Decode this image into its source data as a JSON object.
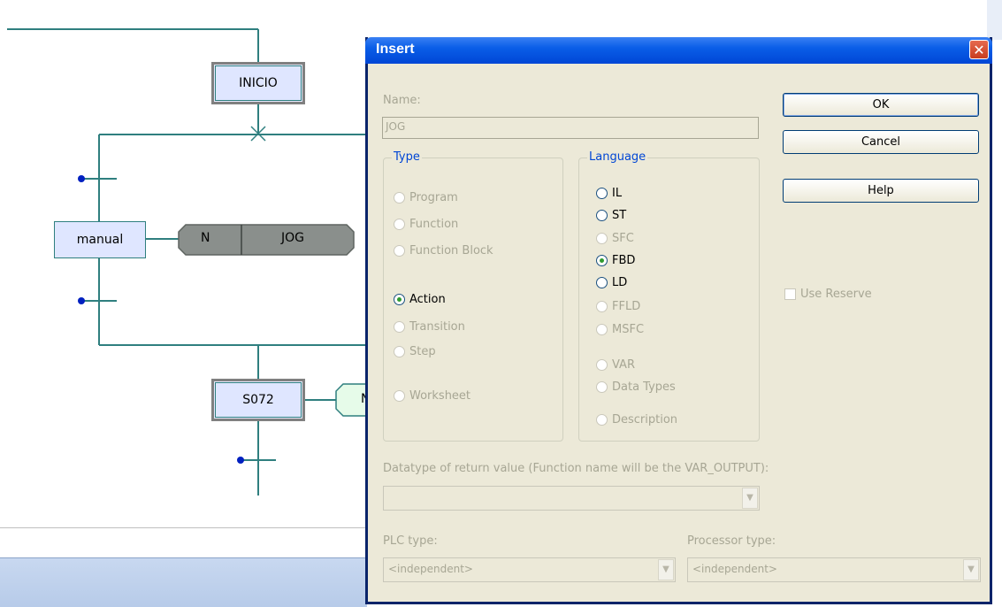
{
  "diagram": {
    "steps": {
      "inicio": "INICIO",
      "manual": "manual",
      "s072": "S072"
    },
    "action": {
      "qualifier": "N",
      "name": "JOG"
    },
    "action2_qualifier": "N"
  },
  "dialog": {
    "title": "Insert",
    "close_glyph": "✕",
    "name_label": "Name:",
    "name_value": "JOG",
    "type_group": {
      "title": "Type",
      "options": [
        "Program",
        "Function",
        "Function Block",
        "Action",
        "Transition",
        "Step",
        "Worksheet"
      ],
      "selected": "Action"
    },
    "language_group": {
      "title": "Language",
      "options": [
        "IL",
        "ST",
        "SFC",
        "FBD",
        "LD",
        "FFLD",
        "MSFC",
        "VAR",
        "Data Types",
        "Description"
      ],
      "selected": "FBD"
    },
    "buttons": {
      "ok": "OK",
      "cancel": "Cancel",
      "help": "Help"
    },
    "use_reserve_label": "Use Reserve",
    "return_type_label": "Datatype of return value (Function name will be the VAR_OUTPUT):",
    "return_type_value": "",
    "plc_type_label": "PLC type:",
    "plc_type_value": "<independent>",
    "processor_type_label": "Processor type:",
    "processor_type_value": "<independent>"
  },
  "colors": {
    "title_bar": "#0a5ee8",
    "dialog_bg": "#ece9d8",
    "link_line": "#2f7f7f",
    "group_title": "#0046d5"
  }
}
